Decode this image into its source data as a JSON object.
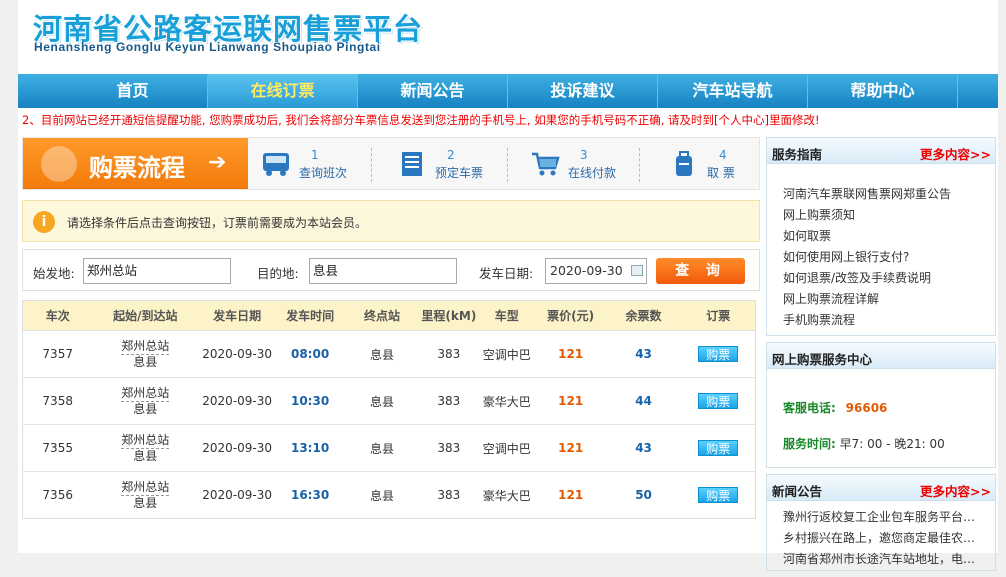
{
  "header": {
    "title_cn": "河南省公路客运联网售票平台",
    "title_en": "Henansheng Gonglu Keyun Lianwang Shoupiao Pingtai"
  },
  "nav": [
    "首页",
    "在线订票",
    "新闻公告",
    "投诉建议",
    "汽车站导航",
    "帮助中心"
  ],
  "notice": "2、目前网站已经开通短信提醒功能, 您购票成功后, 我们会将部分车票信息发送到您注册的手机号上, 如果您的手机号码不正确, 请及时到[个人中心]里面修改!",
  "steps": {
    "title": "购票流程",
    "items": [
      {
        "num": "1",
        "label": "查询班次"
      },
      {
        "num": "2",
        "label": "预定车票"
      },
      {
        "num": "3",
        "label": "在线付款"
      },
      {
        "num": "4",
        "label": "取 票"
      }
    ]
  },
  "tip": "请选择条件后点击查询按钮，订票前需要成为本站会员。",
  "search": {
    "from_label": "始发地:",
    "from_value": "郑州总站",
    "to_label": "目的地:",
    "to_value": "息县",
    "date_label": "发车日期:",
    "date_value": "2020-09-30",
    "button": "查 询"
  },
  "table": {
    "headers": [
      "车次",
      "起始/到达站",
      "发车日期",
      "发车时间",
      "终点站",
      "里程(kM)",
      "车型",
      "票价(元)",
      "余票数",
      "订票"
    ],
    "rows": [
      {
        "no": "7357",
        "from": "郑州总站",
        "to": "息县",
        "date": "2020-09-30",
        "time": "08:00",
        "end": "息县",
        "km": "383",
        "type": "空调中巴",
        "price": "121",
        "remain": "43",
        "buy": "购票"
      },
      {
        "no": "7358",
        "from": "郑州总站",
        "to": "息县",
        "date": "2020-09-30",
        "time": "10:30",
        "end": "息县",
        "km": "383",
        "type": "豪华大巴",
        "price": "121",
        "remain": "44",
        "buy": "购票"
      },
      {
        "no": "7355",
        "from": "郑州总站",
        "to": "息县",
        "date": "2020-09-30",
        "time": "13:10",
        "end": "息县",
        "km": "383",
        "type": "空调中巴",
        "price": "121",
        "remain": "43",
        "buy": "购票"
      },
      {
        "no": "7356",
        "from": "郑州总站",
        "to": "息县",
        "date": "2020-09-30",
        "time": "16:30",
        "end": "息县",
        "km": "383",
        "type": "豪华大巴",
        "price": "121",
        "remain": "50",
        "buy": "购票"
      }
    ]
  },
  "sidebar": {
    "guide": {
      "title": "服务指南",
      "more": "更多内容>>",
      "items": [
        "河南汽车票联网售票网郑重公告",
        "网上购票须知",
        "如何取票",
        "如何使用网上银行支付?",
        "如何退票/改签及手续费说明",
        "网上购票流程详解",
        "手机购票流程"
      ]
    },
    "service": {
      "title": "网上购票服务中心",
      "phone_label": "客服电话:",
      "phone": "96606",
      "hours_label": "服务时间:",
      "hours": "早7: 00 - 晚21: 00"
    },
    "news": {
      "title": "新闻公告",
      "more": "更多内容>>",
      "items": [
        "豫州行返校复工企业包车服务平台…",
        "乡村振兴在路上，邀您商定最佳农…",
        "河南省郑州市长途汽车站地址，电…"
      ]
    }
  }
}
